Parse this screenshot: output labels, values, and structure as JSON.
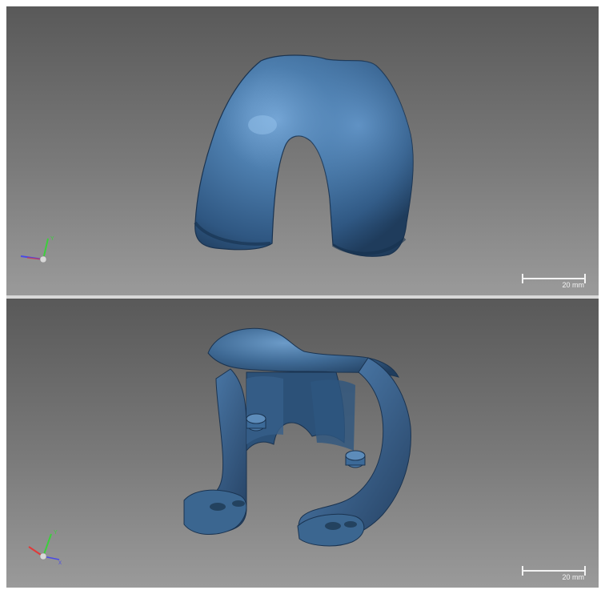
{
  "viewports": [
    {
      "id": "top",
      "scale_bar": {
        "label": "20 mm"
      },
      "triad": {
        "y_label": "Y",
        "x_label": "",
        "z_label": ""
      },
      "object": {
        "name": "femoral-component-front",
        "color": "#3f6a95"
      }
    },
    {
      "id": "bottom",
      "scale_bar": {
        "label": "20 mm"
      },
      "triad": {
        "y_label": "Y",
        "x_label": "X",
        "z_label": ""
      },
      "object": {
        "name": "femoral-component-underside",
        "color": "#36628c"
      }
    }
  ],
  "colors": {
    "background_top": "#595959",
    "background_bottom": "#9a9a9a",
    "axis_x": "#e03a3a",
    "axis_y": "#3ccf3c",
    "axis_z": "#4a4ae6",
    "model": "#3f6a95"
  }
}
